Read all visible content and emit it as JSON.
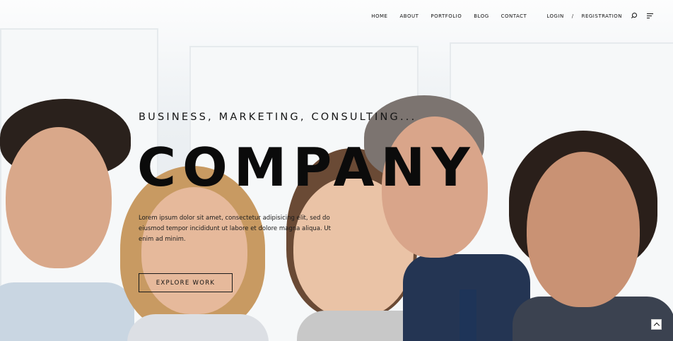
{
  "nav": {
    "items": [
      {
        "label": "HOME"
      },
      {
        "label": "ABOUT"
      },
      {
        "label": "PORTFOLIO"
      },
      {
        "label": "BLOG"
      },
      {
        "label": "CONTACT"
      }
    ],
    "login": "LOGIN",
    "separator": "/",
    "registration": "REGISTRATION",
    "icons": [
      "search-icon",
      "menu-icon"
    ]
  },
  "hero": {
    "tagline": "BUSINESS, MARKETING, CONSULTING...",
    "headline": "COMPANY",
    "description": "Lorem ipsum dolor sit amet, consectetur adipisicing elit, sed do eiusmod tempor incididunt ut labore et dolore magna aliqua. Ut enim ad minim.",
    "cta": "EXPLORE WORK"
  },
  "back_to_top": {
    "icon": "chevron-up-icon"
  }
}
